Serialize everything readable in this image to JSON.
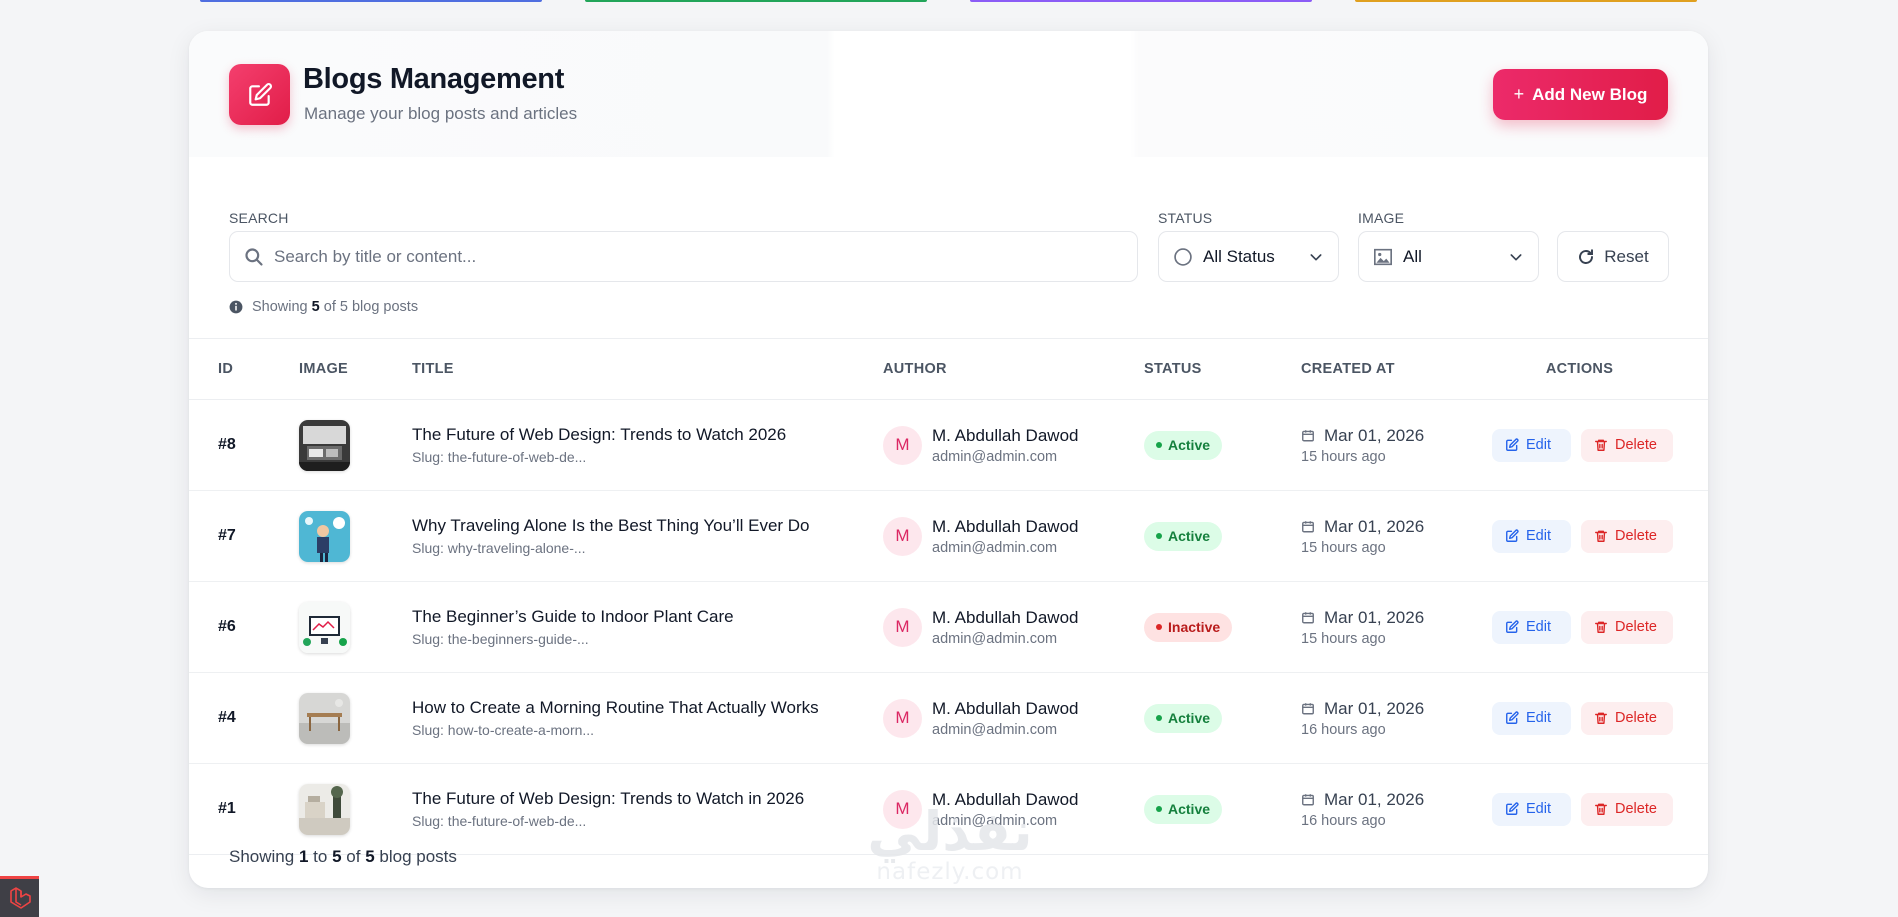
{
  "colors": {
    "accent": "#e11d48",
    "strip_blue": "#4f6ee0",
    "strip_green": "#22a55a",
    "strip_purple": "#8b5cf6",
    "strip_orange": "#e0a020"
  },
  "header": {
    "icon": "edit-square-icon",
    "title": "Blogs Management",
    "subtitle": "Manage your blog posts and articles",
    "add_button": {
      "icon": "plus-icon",
      "label": "Add New Blog"
    }
  },
  "filters": {
    "search": {
      "label": "SEARCH",
      "placeholder": "Search by title or content...",
      "value": ""
    },
    "status": {
      "label": "STATUS",
      "selected": "All Status"
    },
    "image": {
      "label": "IMAGE",
      "selected": "All"
    },
    "reset_label": "Reset",
    "summary": {
      "prefix": "Showing",
      "shown": "5",
      "middle": "of 5 blog posts"
    }
  },
  "table": {
    "columns": [
      "ID",
      "IMAGE",
      "TITLE",
      "AUTHOR",
      "STATUS",
      "CREATED AT",
      "ACTIONS"
    ],
    "edit_label": "Edit",
    "delete_label": "Delete",
    "rows": [
      {
        "id": "#8",
        "title": "The Future of Web Design: Trends to Watch 2026",
        "slug": "Slug: the-future-of-web-de...",
        "avatar": "M",
        "author": "M. Abdullah Dawod",
        "email": "admin@admin.com",
        "status": "Active",
        "status_kind": "active",
        "date": "Mar 01, 2026",
        "ago": "15 hours ago"
      },
      {
        "id": "#7",
        "title": "Why Traveling Alone Is the Best Thing You’ll Ever Do",
        "slug": "Slug: why-traveling-alone-...",
        "avatar": "M",
        "author": "M. Abdullah Dawod",
        "email": "admin@admin.com",
        "status": "Active",
        "status_kind": "active",
        "date": "Mar 01, 2026",
        "ago": "15 hours ago"
      },
      {
        "id": "#6",
        "title": "The Beginner’s Guide to Indoor Plant Care",
        "slug": "Slug: the-beginners-guide-...",
        "avatar": "M",
        "author": "M. Abdullah Dawod",
        "email": "admin@admin.com",
        "status": "Inactive",
        "status_kind": "inactive",
        "date": "Mar 01, 2026",
        "ago": "15 hours ago"
      },
      {
        "id": "#4",
        "title": "How to Create a Morning Routine That Actually Works",
        "slug": "Slug: how-to-create-a-morn...",
        "avatar": "M",
        "author": "M. Abdullah Dawod",
        "email": "admin@admin.com",
        "status": "Active",
        "status_kind": "active",
        "date": "Mar 01, 2026",
        "ago": "16 hours ago"
      },
      {
        "id": "#1",
        "title": "The Future of Web Design: Trends to Watch in 2026",
        "slug": "Slug: the-future-of-web-de...",
        "avatar": "M",
        "author": "M. Abdullah Dawod",
        "email": "admin@admin.com",
        "status": "Active",
        "status_kind": "active",
        "date": "Mar 01, 2026",
        "ago": "16 hours ago"
      }
    ]
  },
  "footer": {
    "prefix": "Showing",
    "from": "1",
    "to_word": "to",
    "to": "5",
    "of_word": "of",
    "total": "5",
    "suffix": "blog posts"
  },
  "watermark": {
    "arabic": "نفذلي",
    "latin": "nafezly.com"
  }
}
